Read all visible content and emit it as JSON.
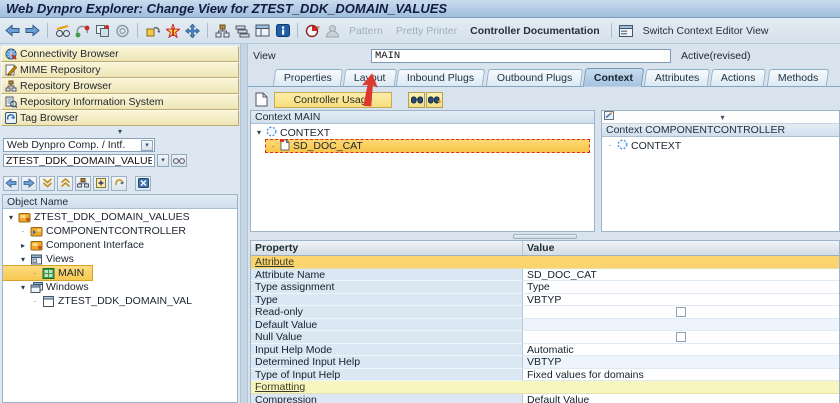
{
  "titlebar": {
    "title": "Web Dynpro Explorer: Change View for ZTEST_DDK_DOMAIN_VALUES"
  },
  "toolbar": {
    "pattern": "Pattern",
    "pretty_printer": "Pretty Printer",
    "controller_documentation": "Controller Documentation",
    "switch_context_editor": "Switch Context Editor View"
  },
  "sidebar": {
    "browsers": [
      {
        "label": "Connectivity Browser"
      },
      {
        "label": "MIME Repository"
      },
      {
        "label": "Repository Browser"
      },
      {
        "label": "Repository Information System"
      },
      {
        "label": "Tag Browser"
      }
    ],
    "object_type": "Web Dynpro Comp. / Intf.",
    "object_name": "ZTEST_DDK_DOMAIN_VALUES",
    "tree_header": "Object Name",
    "tree": [
      {
        "label": "ZTEST_DDK_DOMAIN_VALUES"
      },
      {
        "label": "COMPONENTCONTROLLER"
      },
      {
        "label": "Component Interface"
      },
      {
        "label": "Views"
      },
      {
        "label": "MAIN"
      },
      {
        "label": "Windows"
      },
      {
        "label": "ZTEST_DDK_DOMAIN_VAL"
      }
    ]
  },
  "view_bar": {
    "label": "View",
    "value": "MAIN",
    "status": "Active(revised)"
  },
  "tabs": [
    {
      "label": "Properties"
    },
    {
      "label": "Layout"
    },
    {
      "label": "Inbound Plugs"
    },
    {
      "label": "Outbound Plugs"
    },
    {
      "label": "Context"
    },
    {
      "label": "Attributes"
    },
    {
      "label": "Actions"
    },
    {
      "label": "Methods"
    }
  ],
  "context_toolbar": {
    "controller_usage": "Controller Usage"
  },
  "context_main": {
    "header": "Context MAIN",
    "root": "CONTEXT",
    "attribute": "SD_DOC_CAT"
  },
  "context_controller": {
    "header": "Context COMPONENTCONTROLLER",
    "root": "CONTEXT"
  },
  "properties": {
    "col_property": "Property",
    "col_value": "Value",
    "section_attribute": "Attribute",
    "section_formatting": "Formatting",
    "rows": [
      {
        "property": "Attribute Name",
        "value": "SD_DOC_CAT"
      },
      {
        "property": "Type assignment",
        "value": "Type"
      },
      {
        "property": "Type",
        "value": "VBTYP"
      },
      {
        "property": "Read-only",
        "value": ""
      },
      {
        "property": "Default Value",
        "value": ""
      },
      {
        "property": "Null Value",
        "value": ""
      },
      {
        "property": "Input Help Mode",
        "value": "Automatic"
      },
      {
        "property": "Determined Input Help",
        "value": "VBTYP"
      },
      {
        "property": "Type of Input Help",
        "value": "Fixed values for domains"
      },
      {
        "property": "Compression",
        "value": "Default Value"
      }
    ]
  },
  "colors": {
    "selection": "#f8c94f",
    "annotation": "#dd382c",
    "accent": "#3a6ea5"
  }
}
